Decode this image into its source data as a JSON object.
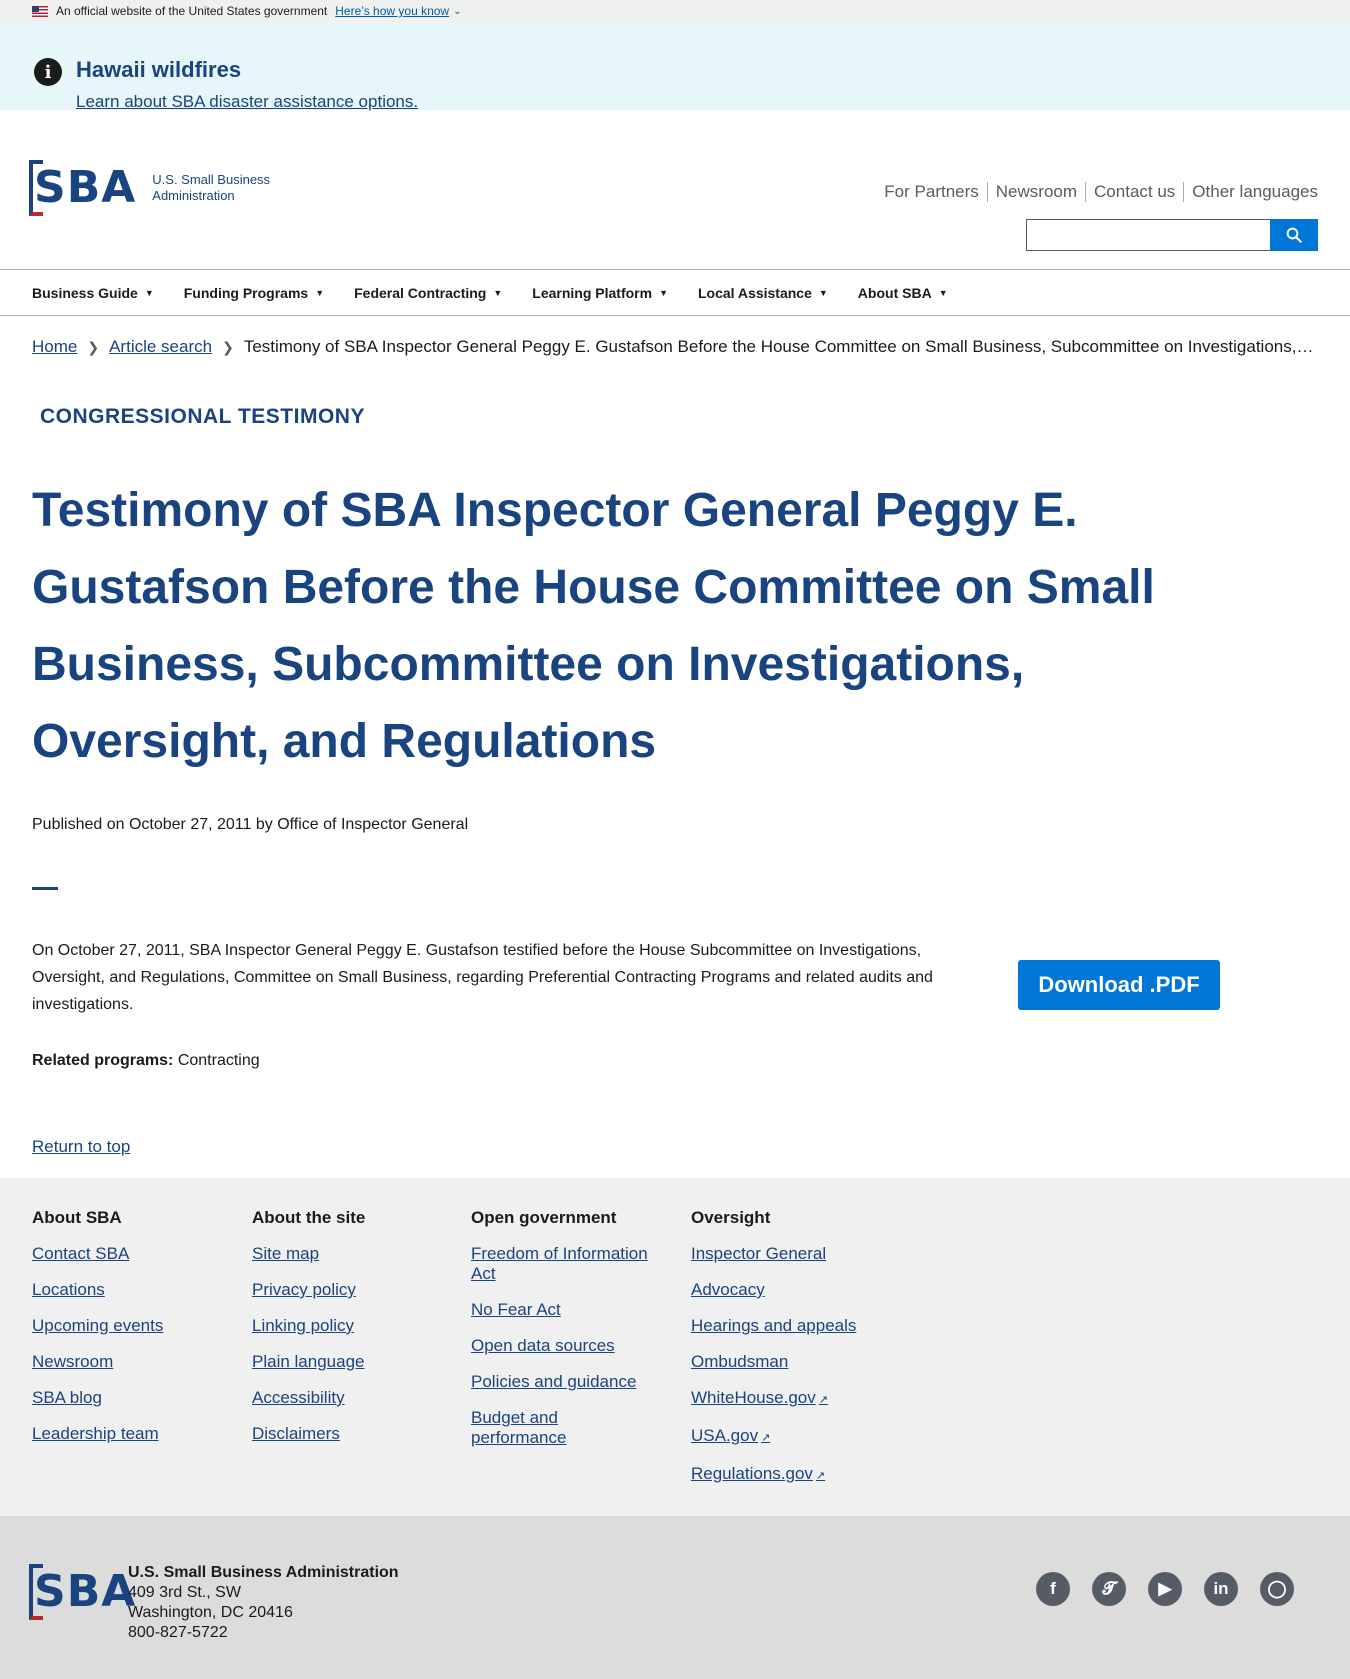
{
  "gov_banner": {
    "text": "An official website of the United States government",
    "how_label": "Here’s how you know"
  },
  "alert": {
    "title": "Hawaii wildfires",
    "link": "Learn about SBA disaster assistance options."
  },
  "header": {
    "logo_text": "SBA",
    "wordmark_line1": "U.S. Small Business",
    "wordmark_line2": "Administration",
    "util_links": [
      "For Partners",
      "Newsroom",
      "Contact us",
      "Other languages"
    ],
    "search_placeholder": ""
  },
  "nav": [
    "Business Guide",
    "Funding Programs",
    "Federal Contracting",
    "Learning Platform",
    "Local Assistance",
    "About SBA"
  ],
  "breadcrumb": {
    "home": "Home",
    "article_search": "Article search",
    "current": "Testimony of SBA Inspector General Peggy E. Gustafson Before the House Committee on Small Business, Subcommittee on Investigations, Oversight, and Regulations"
  },
  "article": {
    "eyebrow": "CONGRESSIONAL TESTIMONY",
    "title": "Testimony of SBA Inspector General Peggy E. Gustafson Before the House Committee on Small Business, Subcommittee on Investigations, Oversight, and Regulations",
    "published": "Published on October 27, 2011 by Office of Inspector General",
    "summary": "On October 27, 2011, SBA Inspector General Peggy E. Gustafson testified before the House Subcommittee on Investigations, Oversight, and Regulations, Committee on Small Business, regarding Preferential Contracting Programs and related audits and investigations.",
    "download_label": "Download .PDF",
    "related_label": "Related programs:",
    "related_value": "Contracting",
    "return_top": "Return to top"
  },
  "footer": {
    "columns": [
      {
        "heading": "About SBA",
        "links": [
          "Contact SBA",
          "Locations",
          "Upcoming events",
          "Newsroom",
          "SBA blog",
          "Leadership team"
        ]
      },
      {
        "heading": "About the site",
        "links": [
          "Site map",
          "Privacy policy",
          "Linking policy",
          "Plain language",
          "Accessibility",
          "Disclaimers"
        ]
      },
      {
        "heading": "Open government",
        "links": [
          "Freedom of Information Act",
          "No Fear Act",
          "Open data sources",
          "Policies and guidance",
          "Budget and performance"
        ]
      },
      {
        "heading": "Oversight",
        "links": [
          "Inspector General",
          "Advocacy",
          "Hearings and appeals",
          "Ombudsman",
          "WhiteHouse.gov",
          "USA.gov",
          "Regulations.gov"
        ]
      }
    ],
    "org_name": "U.S. Small Business Administration",
    "address1": "409 3rd St., SW",
    "address2": "Washington, DC 20416",
    "phone": "800-827-5722",
    "social": [
      "facebook-icon",
      "twitter-icon",
      "youtube-icon",
      "linkedin-icon",
      "instagram-icon"
    ]
  },
  "colors": {
    "brand_blue": "#1a4480",
    "button_blue": "#0076d6",
    "brand_red": "#c1272d",
    "alert_bg": "#e7f6f8"
  }
}
